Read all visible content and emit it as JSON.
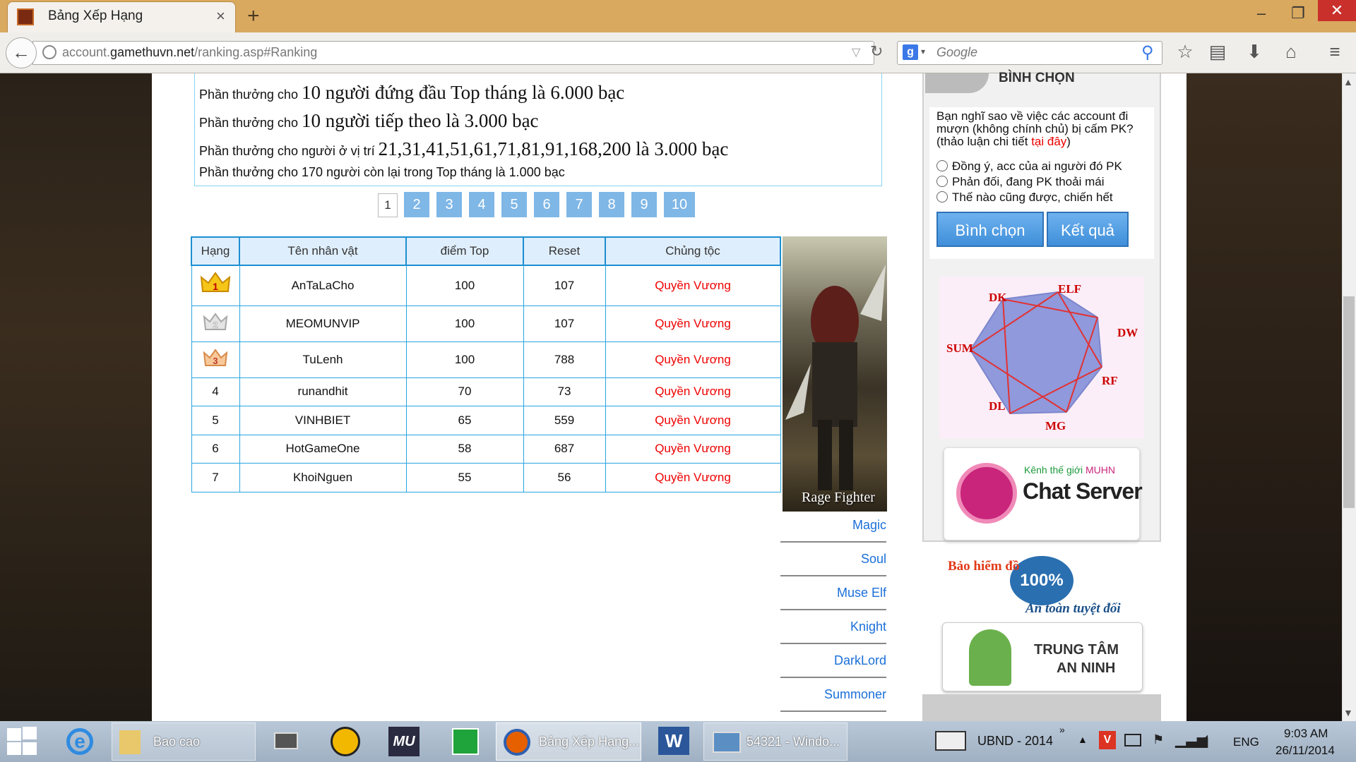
{
  "browser": {
    "tab_title": "Bảng Xếp Hạng",
    "tab_close": "×",
    "new_tab": "+",
    "url_prefix": "account.",
    "url_domain": "gamethuvn.net",
    "url_path": "/ranking.asp#Ranking",
    "search_engine_letter": "g",
    "search_placeholder": "Google",
    "window_minimize": "–",
    "window_restore": "❐",
    "window_close": "✕"
  },
  "rewards": [
    {
      "prefix": "Phần thưởng cho ",
      "big": "10 người đứng đầu Top tháng là 6.000 bạc"
    },
    {
      "prefix": "Phần thưởng cho ",
      "big": "10 người tiếp theo là 3.000 bạc"
    },
    {
      "prefix": "Phần thưởng cho người ở vị trí ",
      "big": "21,31,41,51,61,71,81,91,168,200 là 3.000 bạc"
    },
    {
      "prefix": "Phần thưởng cho 170 người còn lại trong Top tháng là 1.000 bạc",
      "big": ""
    }
  ],
  "pagination": [
    "1",
    "2",
    "3",
    "4",
    "5",
    "6",
    "7",
    "8",
    "9",
    "10"
  ],
  "table": {
    "headers": [
      "Hạng",
      "Tên nhân vật",
      "điểm Top",
      "Reset",
      "Chủng tộc"
    ],
    "rows": [
      {
        "rank": "1",
        "name": "AnTaLaCho",
        "points": "100",
        "reset": "107",
        "race": "Quyền Vương"
      },
      {
        "rank": "2",
        "name": "MEOMUNVIP",
        "points": "100",
        "reset": "107",
        "race": "Quyền Vương"
      },
      {
        "rank": "3",
        "name": "TuLenh",
        "points": "100",
        "reset": "788",
        "race": "Quyền Vương"
      },
      {
        "rank": "4",
        "name": "runandhit",
        "points": "70",
        "reset": "73",
        "race": "Quyền Vương"
      },
      {
        "rank": "5",
        "name": "VINHBIET",
        "points": "65",
        "reset": "559",
        "race": "Quyền Vương"
      },
      {
        "rank": "6",
        "name": "HotGameOne",
        "points": "58",
        "reset": "687",
        "race": "Quyền Vương"
      },
      {
        "rank": "7",
        "name": "KhoiNguen",
        "points": "55",
        "reset": "56",
        "race": "Quyền Vương"
      }
    ]
  },
  "character_caption": "Rage Fighter",
  "class_links": [
    "Magic",
    "Soul",
    "Muse Elf",
    "Knight",
    "DarkLord",
    "Summoner"
  ],
  "poll": {
    "title": "BÌNH CHỌN",
    "question": "Bạn nghĩ sao về việc các account đi mượn (không chính chủ) bị cấm PK? (thảo luận chi tiết ",
    "question_link": "tại đây",
    "question_end": ")",
    "options": [
      "Đồng ý, acc của ai người đó PK",
      "Phản đối, đang PK thoải mái",
      "Thế nào cũng được, chiến hết"
    ],
    "vote_button": "Bình chọn",
    "result_button": "Kết quả"
  },
  "race_diagram": [
    "DK",
    "ELF",
    "DW",
    "RF",
    "MG",
    "DL",
    "SUM"
  ],
  "chat": {
    "subtitle_green": "Kênh thế giới ",
    "subtitle_pink": "MUHN",
    "title": "Chat Server"
  },
  "insurance": {
    "title": "Bảo hiểm đồ",
    "badge": "100%",
    "subtitle": "An toàn tuyệt đối"
  },
  "security": {
    "line1": "TRUNG TÂM",
    "line2": "AN NINH"
  },
  "taskbar": {
    "bao_cao": "Bao cao",
    "firefox": "Bảng Xếp Hạng...",
    "window": "54321 - Windo...",
    "tray_label": "UBND - 2014",
    "lang": "ENG",
    "time": "9:03 AM",
    "date": "26/11/2014"
  }
}
